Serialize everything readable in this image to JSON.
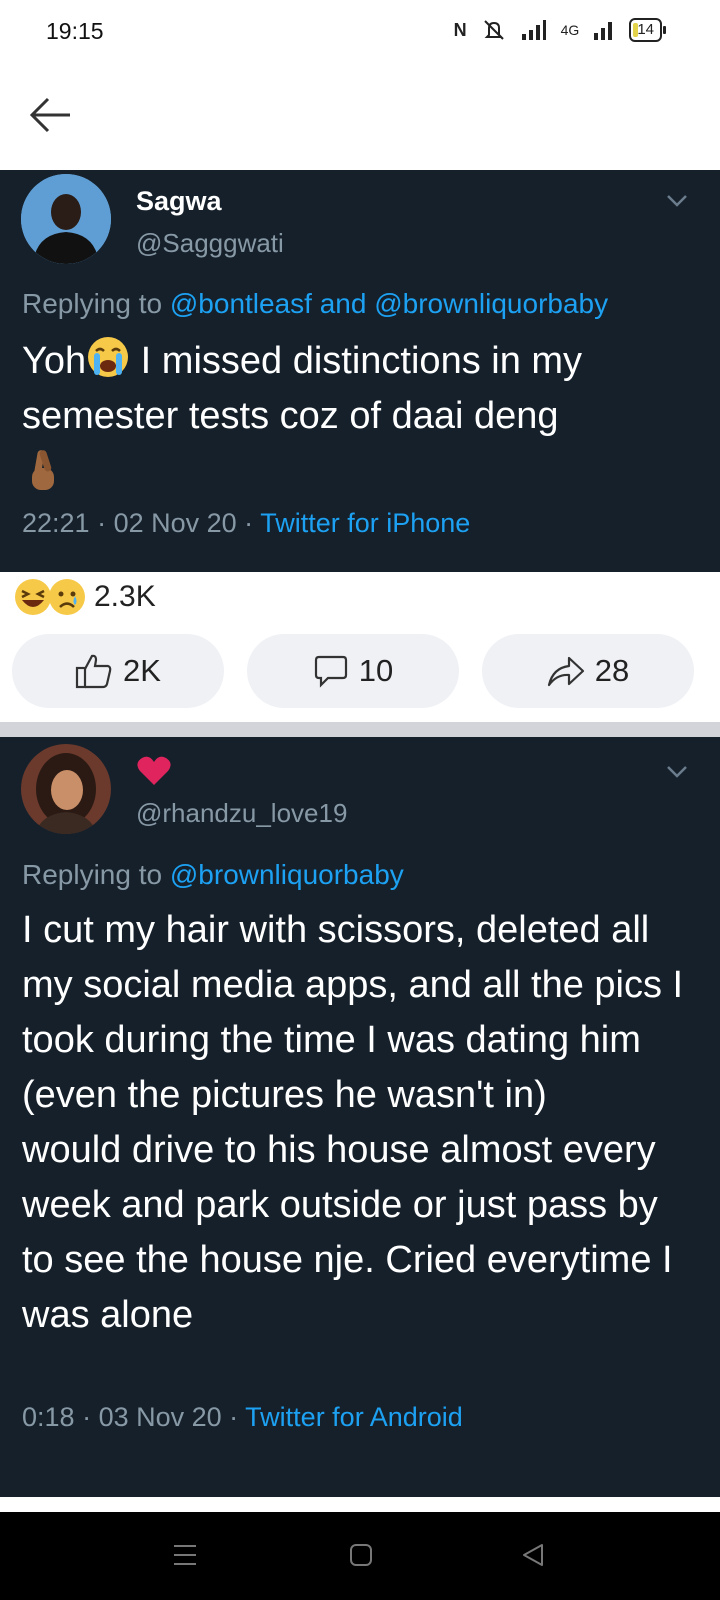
{
  "status_bar": {
    "time": "19:15",
    "network": "4G",
    "battery": "14"
  },
  "tweet1": {
    "name": "Sagwa",
    "handle": "@Sagggwati",
    "replying_prefix": "Replying to ",
    "reply_to_1": "@bontleasf",
    "reply_and": " and ",
    "reply_to_2": "@brownliquorbaby",
    "text_before_emoji": "Yoh",
    "text_after_emoji": " I missed distinctions in my semester tests coz of daai deng",
    "time": "22:21",
    "date": "02 Nov 20",
    "source": "Twitter for iPhone"
  },
  "reactions": {
    "count": "2.3K",
    "like_count": "2K",
    "comment_count": "10",
    "share_count": "28"
  },
  "tweet2": {
    "handle": "@rhandzu_love19",
    "replying_prefix": "Replying to ",
    "reply_to": "@brownliquorbaby",
    "text": "I cut my hair with scissors, deleted all my social media apps, and all the pics I took during the time I was dating him (even the pictures he wasn't in)\nwould drive to his house almost every week and park outside or just pass by to see the house nje. Cried everytime I was alone",
    "time": "0:18",
    "date": "03 Nov 20",
    "source": "Twitter for Android"
  },
  "colors": {
    "card_bg": "#15202b",
    "link": "#1da1f2",
    "muted": "#8899a6",
    "heart": "#e0245e"
  }
}
